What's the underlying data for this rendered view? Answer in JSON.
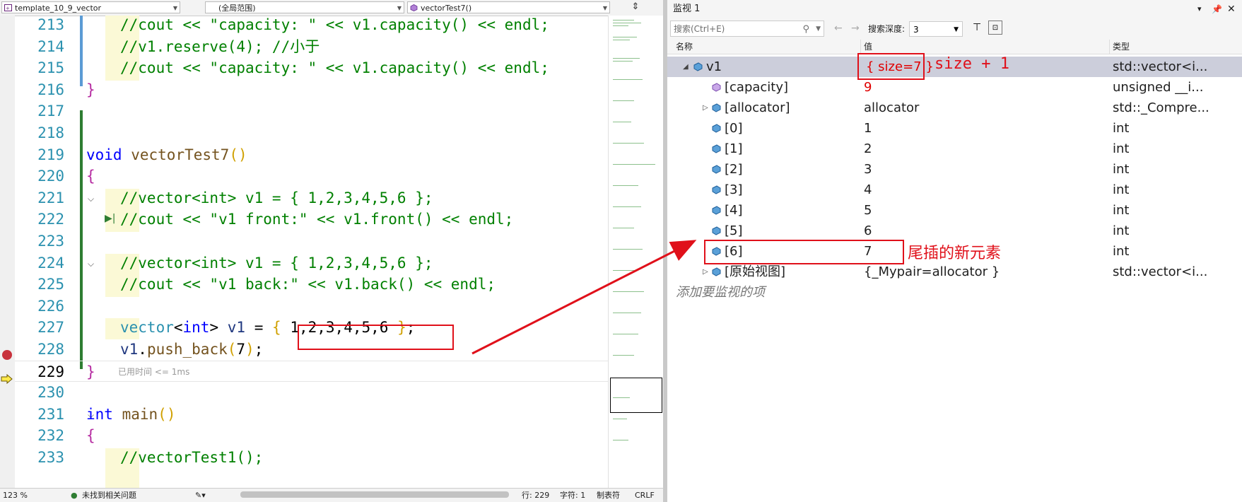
{
  "editor": {
    "file_dropdown": "template_10_9_vector",
    "scope_dropdown": "(全局范围)",
    "member_dropdown": "vectorTest7()",
    "lines": [
      {
        "num": "213",
        "text": "//cout << \"capacity: \" << v1.capacity() << endl;"
      },
      {
        "num": "214",
        "text": "//v1.reserve(4); //小于"
      },
      {
        "num": "215",
        "text": "//cout << \"capacity: \" << v1.capacity() << endl;"
      },
      {
        "num": "216",
        "text": "}"
      },
      {
        "num": "217",
        "text": ""
      },
      {
        "num": "218",
        "text": ""
      },
      {
        "num": "219",
        "text": "void vectorTest7()"
      },
      {
        "num": "220",
        "text": "{"
      },
      {
        "num": "221",
        "text": "//vector<int> v1 = { 1,2,3,4,5,6 };"
      },
      {
        "num": "222",
        "text": "//cout << \"v1 front:\" << v1.front() << endl;"
      },
      {
        "num": "223",
        "text": ""
      },
      {
        "num": "224",
        "text": "//vector<int> v1 = { 1,2,3,4,5,6 };"
      },
      {
        "num": "225",
        "text": "//cout << \"v1 back:\" << v1.back() << endl;"
      },
      {
        "num": "226",
        "text": ""
      },
      {
        "num": "227",
        "text": "vector<int> v1 = { 1,2,3,4,5,6 };"
      },
      {
        "num": "228",
        "text": "v1.push_back(7);"
      },
      {
        "num": "229",
        "text": "}"
      },
      {
        "num": "230",
        "text": ""
      },
      {
        "num": "231",
        "text": "int main()"
      },
      {
        "num": "232",
        "text": "{"
      },
      {
        "num": "233",
        "text": "//vectorTest1();"
      }
    ],
    "elapsed_hint": "已用时间 <= 1ms"
  },
  "statusbar": {
    "zoom": "123 %",
    "issues": "未找到相关问题",
    "line": "行: 229",
    "char": "字符: 1",
    "tab": "制表符",
    "eol": "CRLF"
  },
  "watch": {
    "title": "监视 1",
    "search_placeholder": "搜索(Ctrl+E)",
    "depth_label": "搜索深度:",
    "depth_value": "3",
    "col_name": "名称",
    "col_value": "值",
    "col_type": "类型",
    "rows": [
      {
        "name": "v1",
        "value": "{ size=7 }",
        "type": "std::vector<i..."
      },
      {
        "name": "[capacity]",
        "value": "9",
        "type": "unsigned __i..."
      },
      {
        "name": "[allocator]",
        "value": "allocator",
        "type": "std::_Compre..."
      },
      {
        "name": "[0]",
        "value": "1",
        "type": "int"
      },
      {
        "name": "[1]",
        "value": "2",
        "type": "int"
      },
      {
        "name": "[2]",
        "value": "3",
        "type": "int"
      },
      {
        "name": "[3]",
        "value": "4",
        "type": "int"
      },
      {
        "name": "[4]",
        "value": "5",
        "type": "int"
      },
      {
        "name": "[5]",
        "value": "6",
        "type": "int"
      },
      {
        "name": "[6]",
        "value": "7",
        "type": "int"
      },
      {
        "name": "[原始视图]",
        "value": "{_Mypair=allocator }",
        "type": "std::vector<i..."
      }
    ],
    "add_item": "添加要监视的项"
  },
  "annotations": {
    "size_note": "size + 1",
    "new_elem_note": "尾插的新元素"
  },
  "colors": {
    "annotation_red": "#e0101a",
    "line_number": "#2b91af",
    "comment": "#008000",
    "keyword": "#0000ff"
  }
}
